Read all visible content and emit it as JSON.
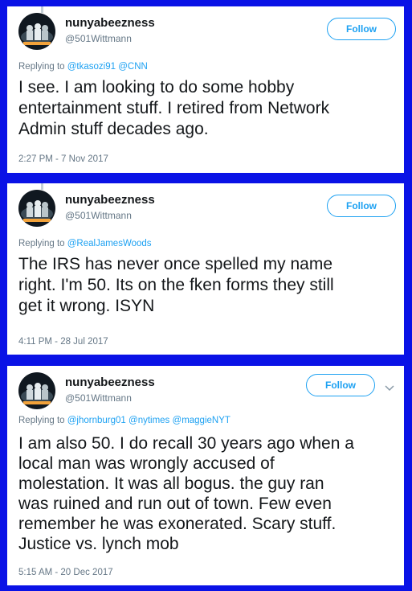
{
  "colors": {
    "background": "#0a12e6",
    "link": "#1da1f2",
    "muted": "#657786"
  },
  "tweets": [
    {
      "name": "nunyabeezness",
      "handle": "@501Wittmann",
      "follow_label": "Follow",
      "reply_prefix": "Replying to",
      "reply_users": [
        "@tkasozi91",
        "@CNN"
      ],
      "text": "I see. I am looking to do some hobby\nentertainment stuff. I retired from Network\nAdmin stuff decades ago.",
      "time": "2:27 PM - 7 Nov 2017"
    },
    {
      "name": "nunyabeezness",
      "handle": "@501Wittmann",
      "follow_label": "Follow",
      "reply_prefix": "Replying to",
      "reply_users": [
        "@RealJamesWoods"
      ],
      "text": "The IRS has never once spelled my name\nright. I'm 50. Its on the fken forms they still\nget it wrong. ISYN",
      "time": "4:11 PM - 28 Jul 2017"
    },
    {
      "name": "nunyabeezness",
      "handle": "@501Wittmann",
      "follow_label": "Follow",
      "reply_prefix": "Replying to",
      "reply_users": [
        "@jhornburg01",
        "@nytimes",
        "@maggieNYT"
      ],
      "text": "I am also 50.  I do recall 30 years ago when a\nlocal man was wrongly accused of\nmolestation. It was all bogus. the guy ran\nwas ruined and run out of town. Few even\nremember he was exonerated. Scary stuff.\nJustice vs. lynch mob",
      "time": "5:15 AM - 20 Dec 2017"
    }
  ]
}
